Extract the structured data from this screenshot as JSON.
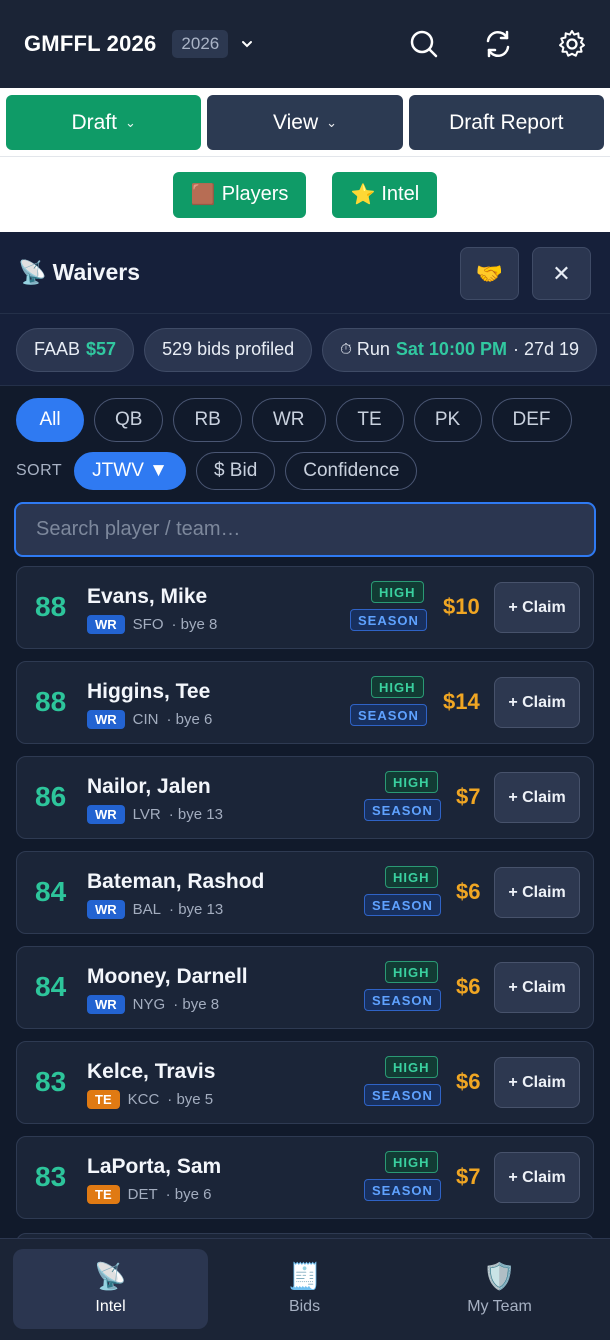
{
  "app": {
    "title": "GMFFL 2026",
    "season": "2026"
  },
  "primary_tabs": [
    {
      "label": "Draft",
      "has_caret": true
    },
    {
      "label": "View",
      "has_caret": true
    },
    {
      "label": "Draft Report",
      "has_caret": false
    }
  ],
  "sub_tabs": [
    {
      "icon": "🟫",
      "label": "Players"
    },
    {
      "icon": "⭐",
      "label": "Intel"
    }
  ],
  "panel": {
    "icon": "📡",
    "title": "Waivers",
    "trade_icon": "🤝",
    "close_icon": "✕"
  },
  "stats": {
    "faab_label": "FAAB",
    "faab_value": "$57",
    "bids_profiled": "529 bids profiled",
    "run_icon": "⏱",
    "run_label": "Run",
    "run_time": "Sat 10:00 PM",
    "run_countdown": "· 27d 19"
  },
  "positions": [
    "All",
    "QB",
    "RB",
    "WR",
    "TE",
    "PK",
    "DEF"
  ],
  "sort": {
    "label": "SORT",
    "options": [
      "JTWV ▼",
      "$ Bid",
      "Confidence"
    ]
  },
  "search": {
    "placeholder": "Search player / team…",
    "value": ""
  },
  "players": [
    {
      "score": "88",
      "name": "Evans, Mike",
      "pos": "WR",
      "team": "SFO",
      "bye": "· bye 8",
      "confidence": "HIGH",
      "term": "SEASON",
      "bid": "$10",
      "claim": "+ Claim"
    },
    {
      "score": "88",
      "name": "Higgins, Tee",
      "pos": "WR",
      "team": "CIN",
      "bye": "· bye 6",
      "confidence": "HIGH",
      "term": "SEASON",
      "bid": "$14",
      "claim": "+ Claim"
    },
    {
      "score": "86",
      "name": "Nailor, Jalen",
      "pos": "WR",
      "team": "LVR",
      "bye": "· bye 13",
      "confidence": "HIGH",
      "term": "SEASON",
      "bid": "$7",
      "claim": "+ Claim"
    },
    {
      "score": "84",
      "name": "Bateman, Rashod",
      "pos": "WR",
      "team": "BAL",
      "bye": "· bye 13",
      "confidence": "HIGH",
      "term": "SEASON",
      "bid": "$6",
      "claim": "+ Claim"
    },
    {
      "score": "84",
      "name": "Mooney, Darnell",
      "pos": "WR",
      "team": "NYG",
      "bye": "· bye 8",
      "confidence": "HIGH",
      "term": "SEASON",
      "bid": "$6",
      "claim": "+ Claim"
    },
    {
      "score": "83",
      "name": "Kelce, Travis",
      "pos": "TE",
      "team": "KCC",
      "bye": "· bye 5",
      "confidence": "HIGH",
      "term": "SEASON",
      "bid": "$6",
      "claim": "+ Claim"
    },
    {
      "score": "83",
      "name": "LaPorta, Sam",
      "pos": "TE",
      "team": "DET",
      "bye": "· bye 6",
      "confidence": "HIGH",
      "term": "SEASON",
      "bid": "$7",
      "claim": "+ Claim"
    }
  ],
  "bottom_nav": [
    {
      "icon": "📡",
      "label": "Intel",
      "active": true
    },
    {
      "icon": "🧾",
      "label": "Bids",
      "active": false
    },
    {
      "icon": "🛡️",
      "label": "My Team",
      "active": false
    }
  ],
  "colors": {
    "brand_green": "#0f9b67",
    "accent_blue": "#2f7af2",
    "score_teal": "#2dc59b",
    "bid_gold": "#f0a623",
    "background": "#111a2b"
  }
}
